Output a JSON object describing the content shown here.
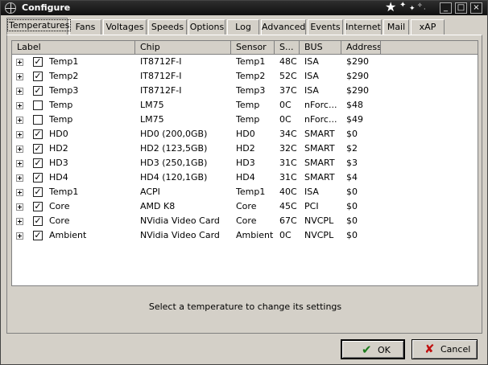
{
  "window": {
    "title": "Configure"
  },
  "titlebar": {
    "minimize": "_",
    "maximize": "□",
    "close": "×",
    "stars": [
      "★",
      "✦",
      "✦",
      "✧",
      "·"
    ]
  },
  "tabs": [
    "Temperatures",
    "Fans",
    "Voltages",
    "Speeds",
    "Options",
    "Log",
    "Advanced",
    "Events",
    "Internet",
    "Mail",
    "xAP"
  ],
  "active_tab": "Temperatures",
  "columns": [
    "Label",
    "Chip",
    "Sensor",
    "S...",
    "BUS",
    "Address"
  ],
  "rows": [
    {
      "checked": true,
      "label": "Temp1",
      "chip": "IT8712F-I",
      "sensor": "Temp1",
      "value": "48C",
      "bus": "ISA",
      "address": "$290"
    },
    {
      "checked": true,
      "label": "Temp2",
      "chip": "IT8712F-I",
      "sensor": "Temp2",
      "value": "52C",
      "bus": "ISA",
      "address": "$290"
    },
    {
      "checked": true,
      "label": "Temp3",
      "chip": "IT8712F-I",
      "sensor": "Temp3",
      "value": "37C",
      "bus": "ISA",
      "address": "$290"
    },
    {
      "checked": false,
      "label": "Temp",
      "chip": "LM75",
      "sensor": "Temp",
      "value": "0C",
      "bus": "nForc...",
      "address": "$48"
    },
    {
      "checked": false,
      "label": "Temp",
      "chip": "LM75",
      "sensor": "Temp",
      "value": "0C",
      "bus": "nForc...",
      "address": "$49"
    },
    {
      "checked": true,
      "label": "HD0",
      "chip": "HD0 (200,0GB)",
      "sensor": "HD0",
      "value": "34C",
      "bus": "SMART",
      "address": "$0"
    },
    {
      "checked": true,
      "label": "HD2",
      "chip": "HD2 (123,5GB)",
      "sensor": "HD2",
      "value": "32C",
      "bus": "SMART",
      "address": "$2"
    },
    {
      "checked": true,
      "label": "HD3",
      "chip": "HD3 (250,1GB)",
      "sensor": "HD3",
      "value": "31C",
      "bus": "SMART",
      "address": "$3"
    },
    {
      "checked": true,
      "label": "HD4",
      "chip": "HD4 (120,1GB)",
      "sensor": "HD4",
      "value": "31C",
      "bus": "SMART",
      "address": "$4"
    },
    {
      "checked": true,
      "label": "Temp1",
      "chip": "ACPI",
      "sensor": "Temp1",
      "value": "40C",
      "bus": "ISA",
      "address": "$0"
    },
    {
      "checked": true,
      "label": "Core",
      "chip": "AMD K8",
      "sensor": "Core",
      "value": "45C",
      "bus": "PCI",
      "address": "$0"
    },
    {
      "checked": true,
      "label": "Core",
      "chip": "NVidia Video Card",
      "sensor": "Core",
      "value": "67C",
      "bus": "NVCPL",
      "address": "$0"
    },
    {
      "checked": true,
      "label": "Ambient",
      "chip": "NVidia Video Card",
      "sensor": "Ambient",
      "value": "0C",
      "bus": "NVCPL",
      "address": "$0"
    }
  ],
  "status_text": "Select a temperature to change its settings",
  "buttons": {
    "ok": "OK",
    "cancel": "Cancel",
    "ok_icon": "✔",
    "cancel_icon": "✘"
  },
  "colors": {
    "ok_icon": "#1a7a1a",
    "cancel_icon": "#c01010"
  }
}
